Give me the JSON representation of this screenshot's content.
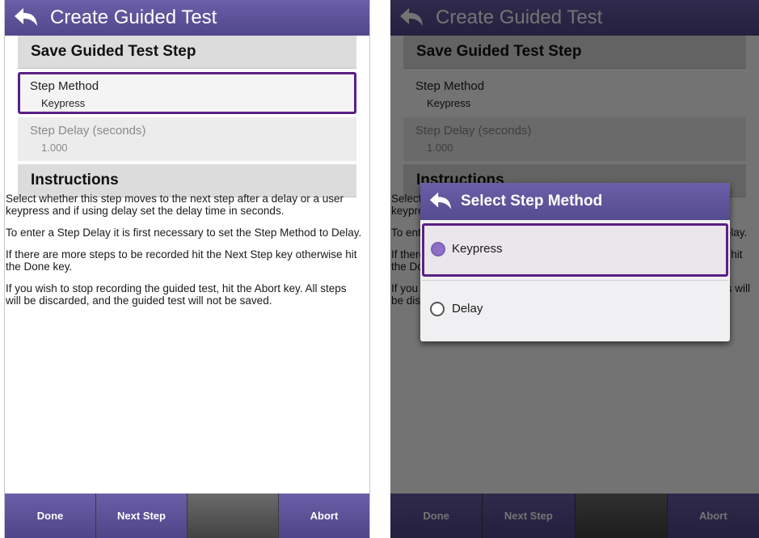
{
  "app": {
    "title": "Create Guided Test"
  },
  "form": {
    "section_title": "Save Guided Test Step",
    "step_method": {
      "label": "Step Method",
      "value": "Keypress"
    },
    "step_delay": {
      "label": "Step Delay (seconds)",
      "value": "1.000"
    },
    "instructions_title": "Instructions",
    "instructions": [
      "Select whether this step moves to the next step after a delay or a user keypress and if using delay set the delay time in seconds.",
      "To enter a Step Delay it is first necessary to set the Step Method to Delay.",
      "If there are more steps to be recorded hit the Next Step key otherwise hit the Done key.",
      "If you wish to stop recording the guided test, hit the Abort key. All steps will be discarded, and the guided test will not be saved."
    ]
  },
  "toolbar": {
    "done": "Done",
    "next_step": "Next Step",
    "abort": "Abort"
  },
  "dialog": {
    "title": "Select Step Method",
    "options": [
      {
        "label": "Keypress",
        "selected": true
      },
      {
        "label": "Delay",
        "selected": false
      }
    ]
  },
  "colors": {
    "accent": "#5a4f98",
    "selection_border": "#5a1f86",
    "toolbar_dark": "#4d4d4d"
  },
  "icons": {
    "back": "back-arrow-icon",
    "radio_on": "radio-selected-icon",
    "radio_off": "radio-unselected-icon"
  }
}
